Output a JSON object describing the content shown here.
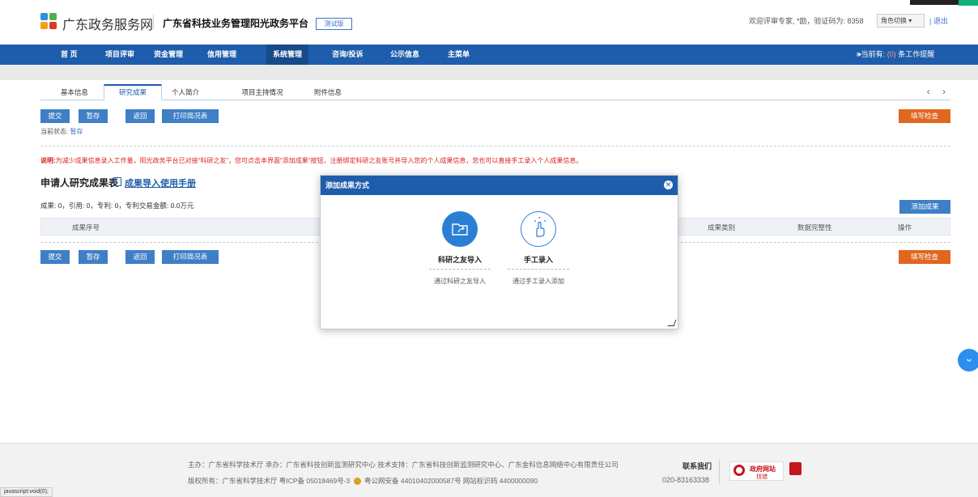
{
  "header": {
    "site_name": "广东政务服务网",
    "platform_name": "广东省科技业务管理阳光政务平台",
    "test_badge": "测试版",
    "welcome_text": "欢迎评审专家, *励，验证码为: 8358",
    "role_switch": "角色切换 ▾",
    "logout": "| 退出"
  },
  "nav": {
    "items": [
      "首 页",
      "项目评审",
      "资金管理",
      "信用管理",
      "系统管理",
      "咨询/投诉",
      "公示信息",
      "主菜单"
    ],
    "active": "系统管理",
    "reminder_prefix": "🕪当前有:",
    "reminder_count": "(0)",
    "reminder_suffix": "条工作提醒"
  },
  "tabs": [
    "基本信息",
    "研究成果",
    "个人简介",
    "项目主持情况",
    "附件信息"
  ],
  "tab_nav": "‹ ›",
  "toolbar": {
    "submit": "提交",
    "save": "暂存",
    "back": "返回",
    "print": "打印简况表",
    "check": "填写检查"
  },
  "status": {
    "label": "当前状态:",
    "value": "暂存"
  },
  "notice": {
    "label": "说明:",
    "text": "为减少成果信息录入工作量，阳光政务平台已对接“科研之友”，您可点击本界面“添加成果”按钮，注册绑定科研之友账号并导入您的个人成果信息，您也可以直接手工录入个人成果信息。"
  },
  "section": {
    "title": "申请人研究成果表",
    "manual_link": "成果导入使用手册",
    "stats": "成果: 0，引用: 0，专利: 0，专利交易金额: 0.0万元",
    "add_button": "添加成果"
  },
  "table": {
    "columns": [
      "成果序号",
      "成果类别",
      "数据完整性",
      "操作"
    ]
  },
  "dialog": {
    "title": "添加成果方式",
    "close": "✕",
    "options": [
      {
        "title": "科研之友导入",
        "desc": "通过科研之友导入",
        "icon": "folder-share-icon"
      },
      {
        "title": "手工录入",
        "desc": "通过手工录入添加",
        "icon": "hand-tap-icon"
      }
    ]
  },
  "footer": {
    "line1": "主办：广东省科学技术厅  承办：广东省科技创新监测研究中心  技术支持：广东省科技创新监测研究中心、广东金科信息网络中心有限责任公司",
    "line2_a": "版权所有：广东省科学技术厅  粤ICP备 05018469号-3",
    "line2_b": "粤公网安备 44010402000587号  网站标识码 4400000090",
    "contact": "联系我们",
    "phone": "020-83163338",
    "badge_t1": "政府网站",
    "badge_t2": "找错"
  },
  "status_bar": "javascript:void(0);",
  "colors": {
    "nav_blue": "#1e5dab",
    "button_blue": "#3f7fc6",
    "orange": "#e1661f",
    "notice_red": "#dd2222"
  }
}
